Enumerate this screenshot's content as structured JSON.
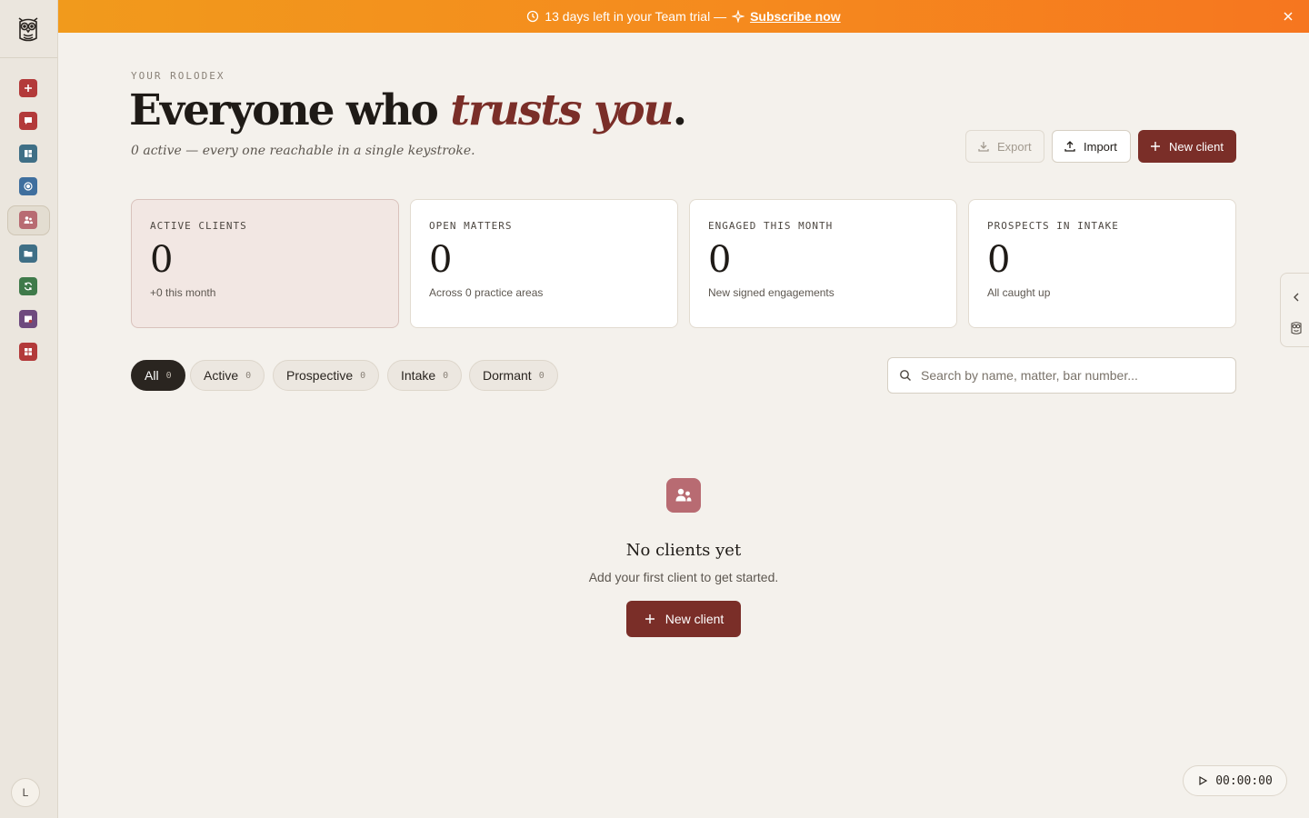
{
  "banner": {
    "trial_text": "13 days left in your Team trial —",
    "subscribe_label": "Subscribe now"
  },
  "sidebar": {
    "items": [
      {
        "name": "new-item",
        "color": "#b33a3a",
        "icon": "plus-icon"
      },
      {
        "name": "messages",
        "color": "#b33a3a",
        "icon": "chat-icon"
      },
      {
        "name": "dashboard",
        "color": "#3f6f86",
        "icon": "dashboard-icon"
      },
      {
        "name": "radar",
        "color": "#3f6f9e",
        "icon": "target-icon"
      },
      {
        "name": "clients",
        "color": "#b86b72",
        "icon": "people-icon"
      },
      {
        "name": "matters",
        "color": "#3f6f86",
        "icon": "folder-icon"
      },
      {
        "name": "billing",
        "color": "#3f7a4a",
        "icon": "refresh-icon"
      },
      {
        "name": "inbox",
        "color": "#6e4a7e",
        "icon": "inbox-icon"
      },
      {
        "name": "apps",
        "color": "#b33a3a",
        "icon": "grid-icon"
      }
    ],
    "avatar_initial": "L"
  },
  "header": {
    "eyebrow": "YOUR ROLODEX",
    "title_plain": "Everyone who ",
    "title_emphasis": "trusts you",
    "title_period": ".",
    "subtitle": "0 active — every one reachable in a single keystroke.",
    "export_label": "Export",
    "import_label": "Import",
    "new_client_label": "New client"
  },
  "stats": [
    {
      "label": "ACTIVE CLIENTS",
      "value": "0",
      "note": "+0 this month"
    },
    {
      "label": "OPEN MATTERS",
      "value": "0",
      "note": "Across 0 practice areas"
    },
    {
      "label": "ENGAGED THIS MONTH",
      "value": "0",
      "note": "New signed engagements"
    },
    {
      "label": "PROSPECTS IN INTAKE",
      "value": "0",
      "note": "All caught up"
    }
  ],
  "filters": [
    {
      "label": "All",
      "count": "0"
    },
    {
      "label": "Active",
      "count": "0"
    },
    {
      "label": "Prospective",
      "count": "0"
    },
    {
      "label": "Intake",
      "count": "0"
    },
    {
      "label": "Dormant",
      "count": "0"
    }
  ],
  "search": {
    "placeholder": "Search by name, matter, bar number..."
  },
  "empty": {
    "title": "No clients yet",
    "subtitle": "Add your first client to get started.",
    "button_label": "New client"
  },
  "timer": {
    "value": "00:00:00"
  },
  "colors": {
    "accent": "#7a2e28",
    "banner": "#f58a1e",
    "background": "#f4f1ec"
  }
}
